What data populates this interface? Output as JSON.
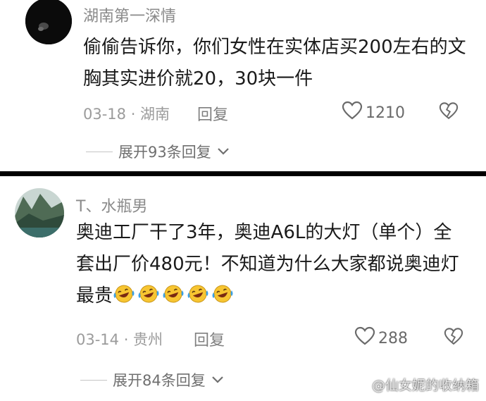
{
  "comments": [
    {
      "username": "湖南第一深情",
      "text": "偷偷告诉你，你们女性在实体店买200左右的文胸其实进价就20，30块一件",
      "date": "03-18 · 湖南",
      "reply_label": "回复",
      "likes": "1210",
      "expand_label": "展开93条回复"
    },
    {
      "username": "T、水瓶男",
      "text": "奥迪工厂干了3年，奥迪A6L的大灯（单个）全套出厂价480元！不知道为什么大家都说奥迪灯最贵",
      "emoji_count": 5,
      "emoji_name": "laughing-crying-emoji",
      "date": "03-14 · 贵州",
      "reply_label": "回复",
      "likes": "288",
      "expand_label": "展开84条回复"
    }
  ],
  "icons": {
    "like": "heart-outline-icon",
    "dislike": "broken-heart-icon",
    "expand": "chevron-down-icon"
  },
  "watermark": "@仙女妮的收纳箱",
  "colors": {
    "emoji_face": "#f7c531",
    "emoji_tears": "#3aa0e8",
    "text_dark": "#1a1a1a",
    "text_gray": "#8a8a8a"
  }
}
